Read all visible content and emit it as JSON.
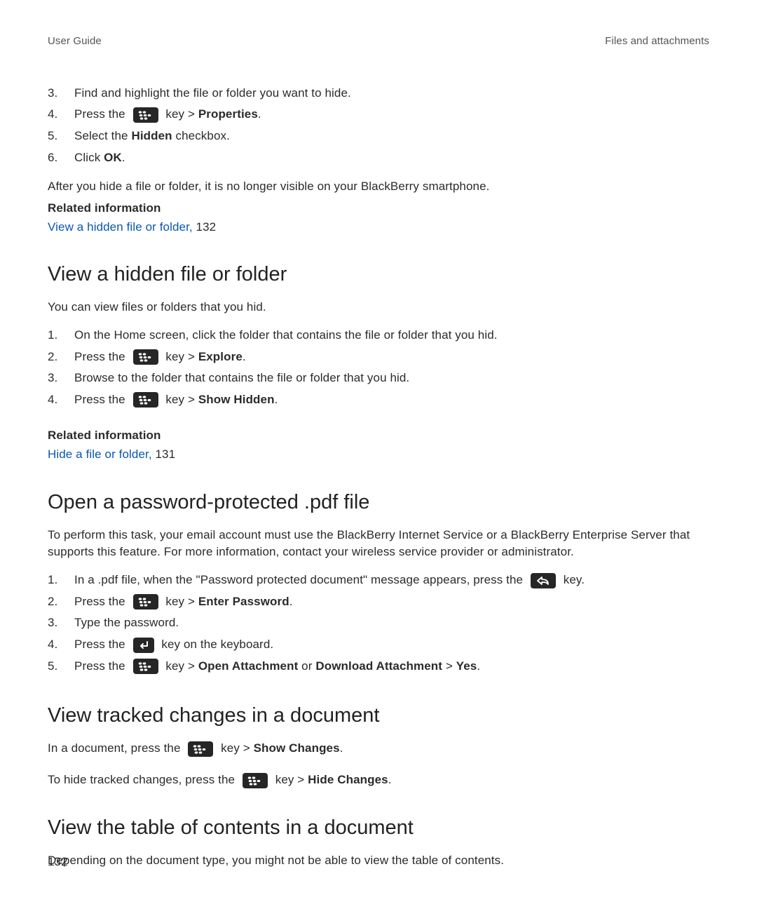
{
  "header": {
    "left": "User Guide",
    "right": "Files and attachments"
  },
  "page_number": "132",
  "intro_steps": {
    "s3": {
      "n": "3.",
      "t": "Find and highlight the file or folder you want to hide."
    },
    "s4": {
      "n": "4.",
      "pre": "Press the ",
      "mid": " key > ",
      "bold": "Properties",
      "post": "."
    },
    "s5": {
      "n": "5.",
      "pre": "Select the ",
      "bold": "Hidden",
      "post": " checkbox."
    },
    "s6": {
      "n": "6.",
      "pre": "Click ",
      "bold": "OK",
      "post": "."
    }
  },
  "intro_after": "After you hide a file or folder, it is no longer visible on your BlackBerry smartphone.",
  "intro_related_head": "Related information",
  "intro_related_link": "View a hidden file or folder,",
  "intro_related_page": " 132",
  "sect1": {
    "title": "View a hidden file or folder",
    "intro": "You can view files or folders that you hid.",
    "s1": {
      "n": "1.",
      "t": "On the Home screen, click the folder that contains the file or folder that you hid."
    },
    "s2": {
      "n": "2.",
      "pre": "Press the ",
      "mid": " key > ",
      "bold": "Explore",
      "post": "."
    },
    "s3": {
      "n": "3.",
      "t": "Browse to the folder that contains the file or folder that you hid."
    },
    "s4": {
      "n": "4.",
      "pre": "Press the ",
      "mid": " key > ",
      "bold": "Show Hidden",
      "post": "."
    },
    "related_head": "Related information",
    "related_link": "Hide a file or folder,",
    "related_page": " 131"
  },
  "sect2": {
    "title": "Open a password-protected .pdf file",
    "intro": "To perform this task, your email account must use the BlackBerry Internet Service or a BlackBerry Enterprise Server that supports this feature. For more information, contact your wireless service provider or administrator.",
    "s1": {
      "n": "1.",
      "pre": "In a .pdf file, when the \"Password protected document\" message appears, press the ",
      "post": " key."
    },
    "s2": {
      "n": "2.",
      "pre": "Press the ",
      "mid": " key > ",
      "bold": "Enter Password",
      "post": "."
    },
    "s3": {
      "n": "3.",
      "t": "Type the password."
    },
    "s4": {
      "n": "4.",
      "pre": "Press the ",
      "post": " key on the keyboard."
    },
    "s5": {
      "n": "5.",
      "pre": "Press the ",
      "mid": " key > ",
      "b1": "Open Attachment",
      "or": " or ",
      "b2": "Download Attachment",
      "gt": " > ",
      "b3": "Yes",
      "post": "."
    }
  },
  "sect3": {
    "title": "View tracked changes in a document",
    "p1": {
      "pre": "In a document, press the ",
      "mid": " key > ",
      "bold": "Show Changes",
      "post": "."
    },
    "p2": {
      "pre": "To hide tracked changes, press the ",
      "mid": " key > ",
      "bold": "Hide Changes",
      "post": "."
    }
  },
  "sect4": {
    "title": "View the table of contents in a document",
    "intro": "Depending on the document type, you might not be able to view the table of contents."
  }
}
